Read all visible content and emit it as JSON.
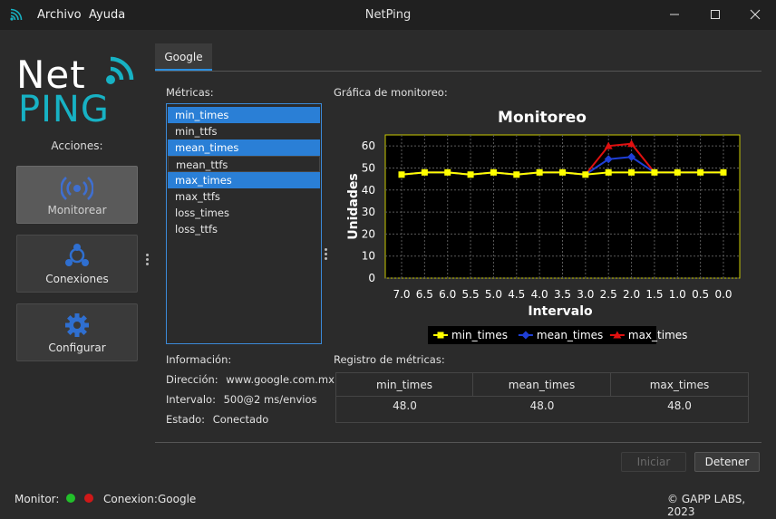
{
  "titlebar": {
    "title": "NetPing",
    "menu": [
      "Archivo",
      "Ayuda"
    ]
  },
  "sidebar": {
    "logo_top": "Net",
    "logo_bottom": "PING",
    "actions_label": "Acciones:",
    "buttons": [
      {
        "label": "Monitorear",
        "icon": "broadcast-icon",
        "active": true
      },
      {
        "label": "Conexiones",
        "icon": "network-icon",
        "active": false
      },
      {
        "label": "Configurar",
        "icon": "gear-icon",
        "active": false
      }
    ]
  },
  "tab": {
    "label": "Google"
  },
  "metrics": {
    "label": "Métricas:",
    "items": [
      {
        "label": "min_times",
        "selected": true
      },
      {
        "label": "min_ttfs",
        "selected": false
      },
      {
        "label": "mean_times",
        "selected": true
      },
      {
        "label": "mean_ttfs",
        "selected": false
      },
      {
        "label": "max_times",
        "selected": true
      },
      {
        "label": "max_ttfs",
        "selected": false
      },
      {
        "label": "loss_times",
        "selected": false
      },
      {
        "label": "loss_ttfs",
        "selected": false
      }
    ]
  },
  "chart_section": {
    "label": "Gráfica de monitoreo:"
  },
  "chart_data": {
    "type": "line",
    "title": "Monitoreo",
    "xlabel": "Intervalo",
    "ylabel": "Unidades",
    "x": [
      "7.0",
      "6.5",
      "6.0",
      "5.5",
      "5.0",
      "4.5",
      "4.0",
      "3.5",
      "3.0",
      "2.5",
      "2.0",
      "1.5",
      "1.0",
      "0.5",
      "0.0"
    ],
    "ylim": [
      0,
      65
    ],
    "yticks": [
      0,
      10,
      20,
      30,
      40,
      50,
      60
    ],
    "grid": true,
    "legend_position": "bottom",
    "series": [
      {
        "name": "min_times",
        "color": "#ffff00",
        "marker": "square",
        "values": [
          47,
          48,
          48,
          47,
          48,
          47,
          48,
          48,
          47,
          48,
          48,
          48,
          48,
          48,
          48
        ]
      },
      {
        "name": "mean_times",
        "color": "#1f3fd6",
        "marker": "diamond",
        "values": [
          47,
          48,
          48,
          47,
          48,
          47,
          48,
          48,
          47,
          54,
          55,
          48,
          48,
          48,
          48
        ]
      },
      {
        "name": "max_times",
        "color": "#e01010",
        "marker": "triangle",
        "values": [
          47,
          48,
          48,
          47,
          48,
          47,
          48,
          48,
          47,
          60,
          61,
          48,
          48,
          48,
          48
        ]
      }
    ]
  },
  "info": {
    "label": "Información:",
    "direccion_label": "Dirección:",
    "direccion": "www.google.com.mx",
    "intervalo_label": "Intervalo:",
    "intervalo": "500@2 ms/envios",
    "estado_label": "Estado:",
    "estado": "Conectado"
  },
  "registro": {
    "label": "Registro de métricas:",
    "columns": [
      "min_times",
      "mean_times",
      "max_times"
    ],
    "values": [
      "48.0",
      "48.0",
      "48.0"
    ]
  },
  "buttons": {
    "start": "Iniciar",
    "stop": "Detener"
  },
  "statusbar": {
    "monitor_label": "Monitor:",
    "conexion_label": "Conexion:",
    "conexion": "Google",
    "copyright": "© GAPP LABS, 2023",
    "led_colors": [
      "#22c02a",
      "#d01818"
    ]
  }
}
